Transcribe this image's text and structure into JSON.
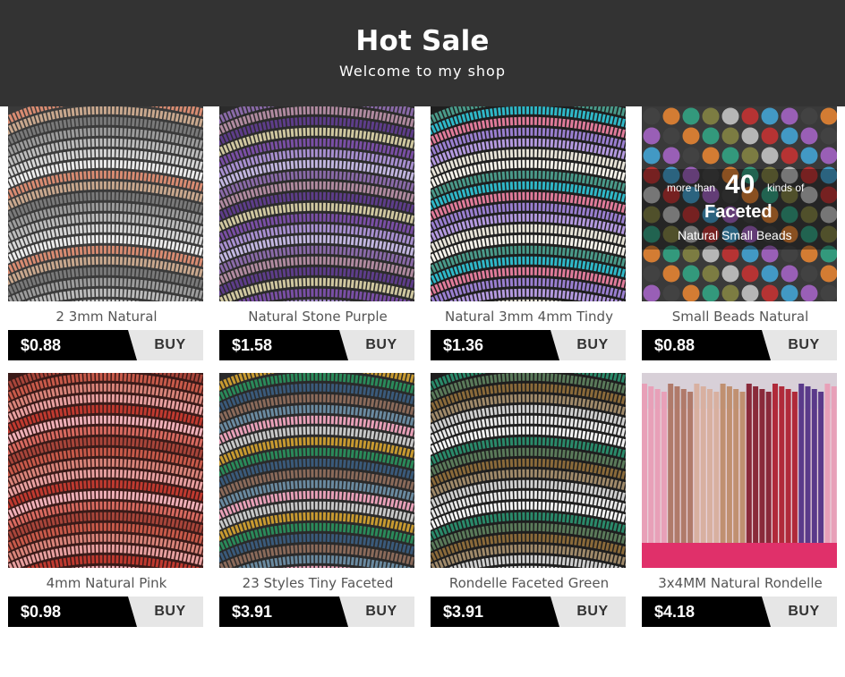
{
  "header": {
    "title": "Hot Sale",
    "subtitle": "Welcome to my shop"
  },
  "products": [
    {
      "name": "2 3mm Natural",
      "price": "$0.88",
      "buy_label": "BUY",
      "colors": [
        "#3a3a3a",
        "#d98c72",
        "#c9a88e",
        "#7a7a7a",
        "#9d9d9d",
        "#bdbdbd",
        "#d7d7d7",
        "#ececec"
      ]
    },
    {
      "name": "Natural Stone Purple",
      "price": "$1.58",
      "buy_label": "BUY",
      "colors": [
        "#2b2b2b",
        "#8a6aa8",
        "#b08aa0",
        "#5e3d8a",
        "#d0c8a0",
        "#7a4fa5",
        "#a88fd0",
        "#c2b6e0"
      ]
    },
    {
      "name": "Natural 3mm 4mm Tindy",
      "price": "$1.36",
      "buy_label": "BUY",
      "colors": [
        "#1e1e1e",
        "#4a9a8a",
        "#2fb8c8",
        "#e07b9a",
        "#9a7fd0",
        "#b49ae0",
        "#e8e4d8",
        "#f5f2ea"
      ]
    },
    {
      "name": "Small Beads Natural",
      "price": "$0.88",
      "buy_label": "BUY",
      "colors": [
        "#444",
        "#c33",
        "#3a8",
        "#a6c",
        "#ccc",
        "#e83",
        "#4ad",
        "#884"
      ],
      "overlay": {
        "line1_prefix": "more than",
        "line1_number": "40",
        "line1_suffix": "kinds of",
        "line2": "Faceted",
        "line3": "Natural Small Beads"
      }
    },
    {
      "name": "4mm Natural Pink",
      "price": "$0.98",
      "buy_label": "BUY",
      "colors": [
        "#3a1a18",
        "#a8453a",
        "#c85a4a",
        "#d9847a",
        "#e8a0a0",
        "#c03a30",
        "#f0b0b8",
        "#d86a60"
      ]
    },
    {
      "name": "23 Styles Tiny Faceted",
      "price": "$3.91",
      "buy_label": "BUY",
      "colors": [
        "#2a2a2a",
        "#c89a30",
        "#2a8a5a",
        "#3a5a7a",
        "#8a6a5a",
        "#6a8aa0",
        "#e8a0b8",
        "#c8c8c8"
      ]
    },
    {
      "name": "Rondelle Faceted Green",
      "price": "$3.91",
      "buy_label": "BUY",
      "colors": [
        "#1e1e1e",
        "#2a8a6a",
        "#5a7a5a",
        "#8a6a3a",
        "#a08a6a",
        "#d0d0d0",
        "#e8e8e8",
        "#f4f4f4"
      ]
    },
    {
      "name": "3x4MM Natural Rondelle",
      "price": "$4.18",
      "buy_label": "BUY",
      "colors": [
        "#e8d0d8",
        "#e8a0b8",
        "#b07a6a",
        "#d8b0a0",
        "#c09070",
        "#8a2a3a",
        "#b02a3a",
        "#5a3a8a"
      ]
    }
  ]
}
